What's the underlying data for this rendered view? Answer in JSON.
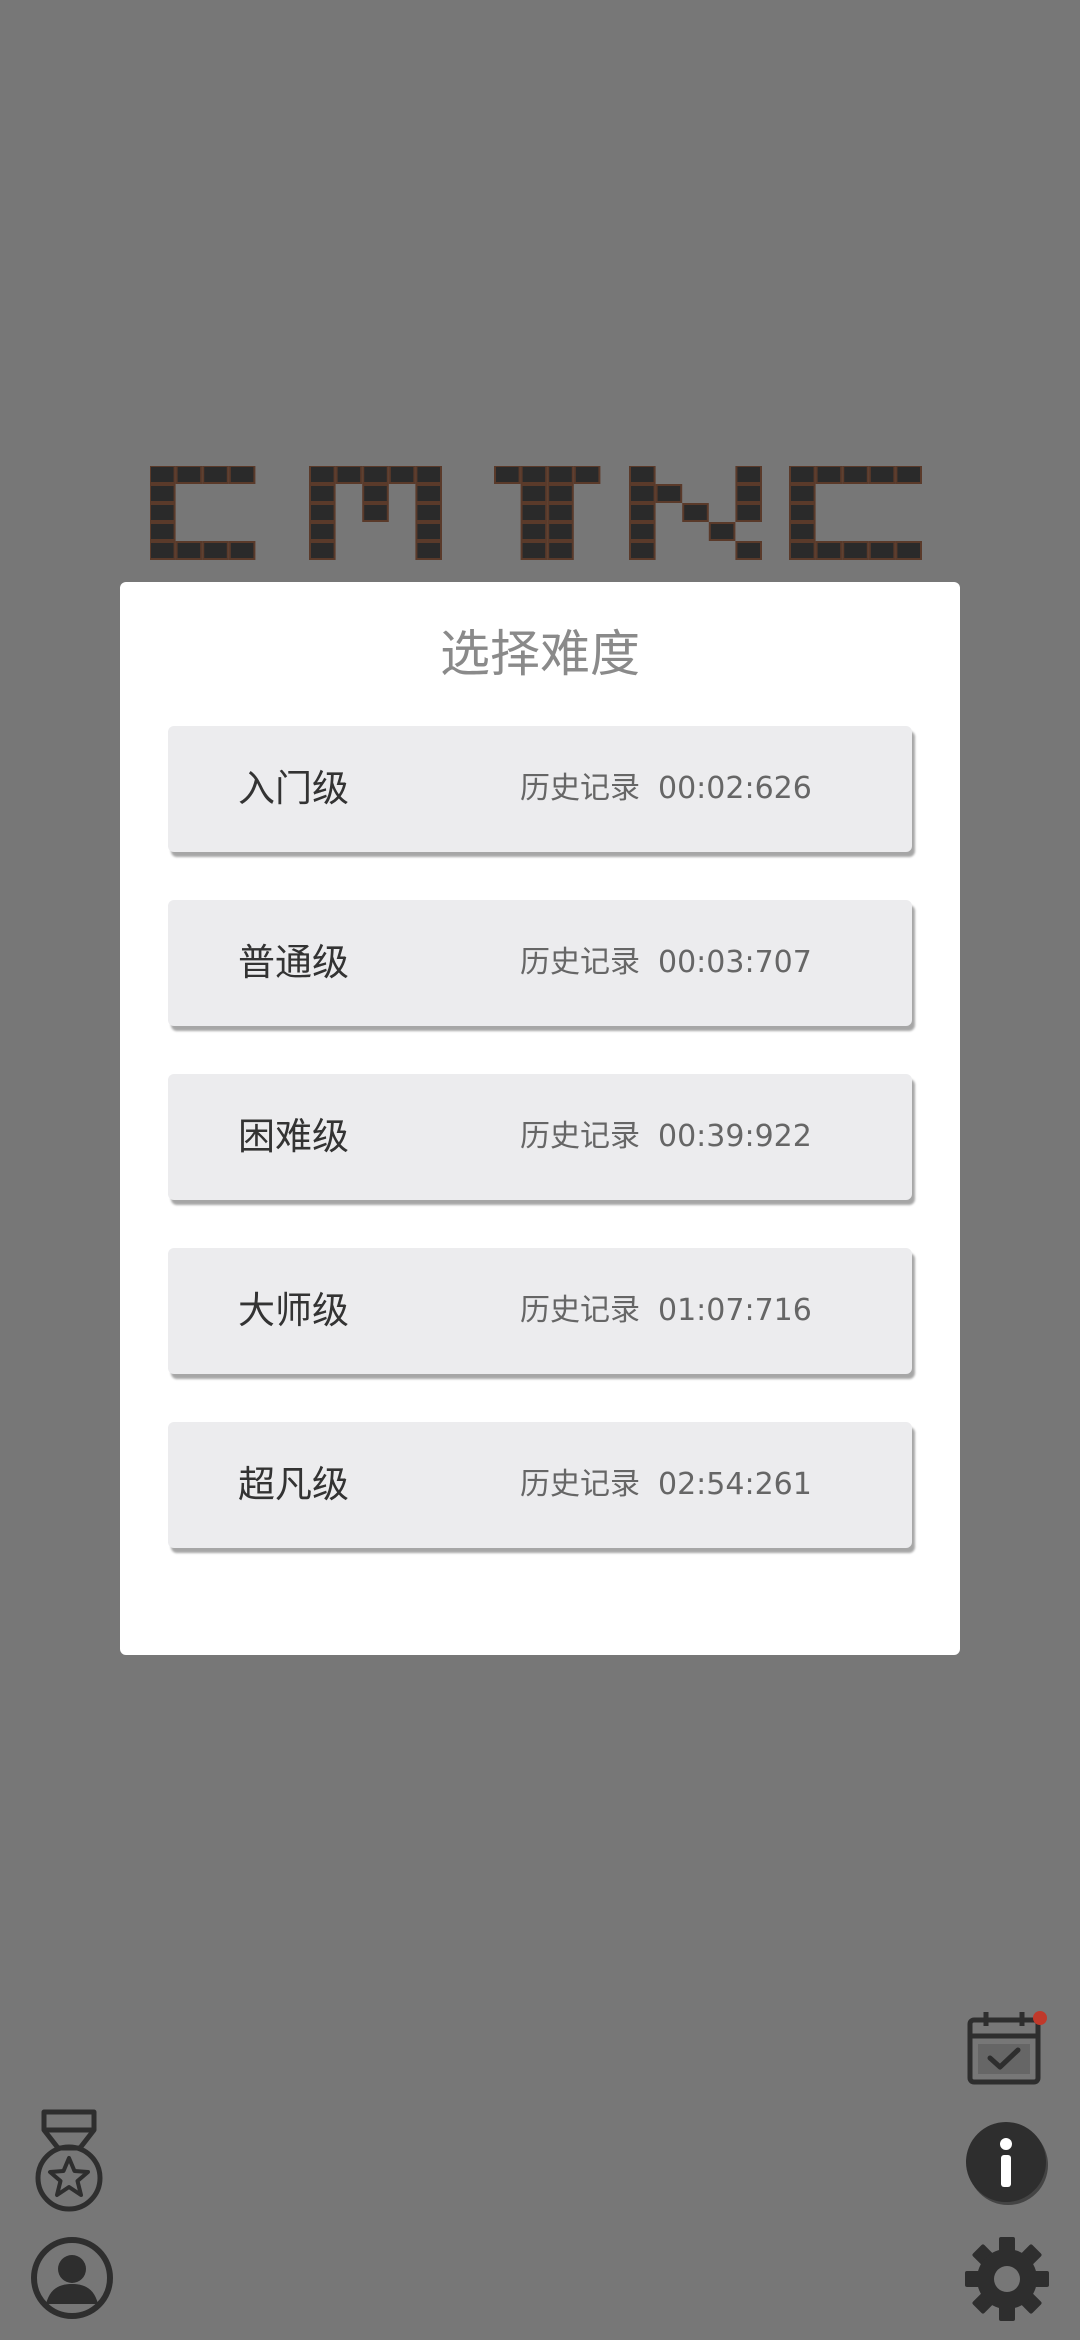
{
  "logo": {
    "alt": "logo-banner"
  },
  "dialog": {
    "title": "选择难度",
    "levels": [
      {
        "name": "入门级",
        "record_label": "历史记录",
        "record_time": "00:02:626"
      },
      {
        "name": "普通级",
        "record_label": "历史记录",
        "record_time": "00:03:707"
      },
      {
        "name": "困难级",
        "record_label": "历史记录",
        "record_time": "00:39:922"
      },
      {
        "name": "大师级",
        "record_label": "历史记录",
        "record_time": "01:07:716"
      },
      {
        "name": "超凡级",
        "record_label": "历史记录",
        "record_time": "02:54:261"
      }
    ]
  },
  "icons": {
    "medal": "medal-icon",
    "profile": "user-profile-icon",
    "calendar": "calendar-check-icon",
    "info": "info-icon",
    "settings": "gear-icon"
  },
  "colors": {
    "background": "#777777",
    "dialog": "#ffffff",
    "button": "#ececee",
    "notification_dot": "#c0392b",
    "icon": "#2e2e2e"
  }
}
